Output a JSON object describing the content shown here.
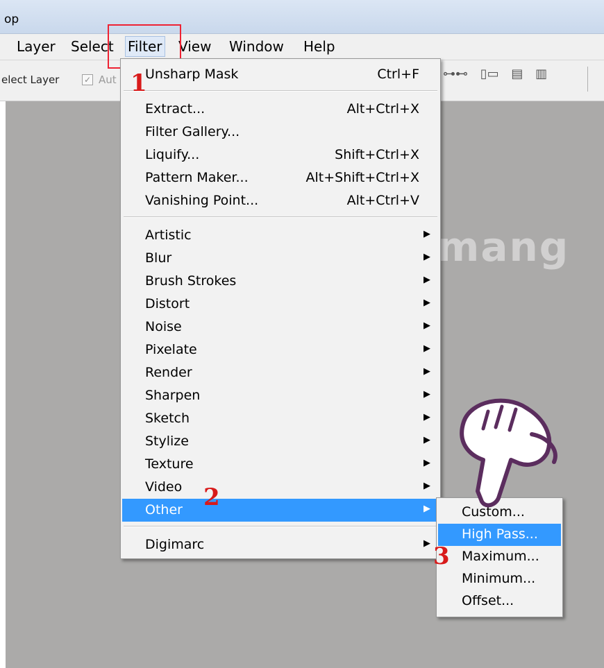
{
  "window": {
    "title_fragment": "op"
  },
  "menubar": {
    "items": [
      {
        "label": "Layer"
      },
      {
        "label": "Select"
      },
      {
        "label": "Filter"
      },
      {
        "label": "View"
      },
      {
        "label": "Window"
      },
      {
        "label": "Help"
      }
    ]
  },
  "toolbar": {
    "select_layer_label": "elect Layer",
    "auto_label": "Aut"
  },
  "filter_menu": {
    "top_item": {
      "label": "Unsharp Mask",
      "shortcut": "Ctrl+F"
    },
    "group1": [
      {
        "label": "Extract...",
        "shortcut": "Alt+Ctrl+X"
      },
      {
        "label": "Filter Gallery...",
        "shortcut": ""
      },
      {
        "label": "Liquify...",
        "shortcut": "Shift+Ctrl+X"
      },
      {
        "label": "Pattern Maker...",
        "shortcut": "Alt+Shift+Ctrl+X"
      },
      {
        "label": "Vanishing Point...",
        "shortcut": "Alt+Ctrl+V"
      }
    ],
    "group2": [
      {
        "label": "Artistic"
      },
      {
        "label": "Blur"
      },
      {
        "label": "Brush Strokes"
      },
      {
        "label": "Distort"
      },
      {
        "label": "Noise"
      },
      {
        "label": "Pixelate"
      },
      {
        "label": "Render"
      },
      {
        "label": "Sharpen"
      },
      {
        "label": "Sketch"
      },
      {
        "label": "Stylize"
      },
      {
        "label": "Texture"
      },
      {
        "label": "Video"
      },
      {
        "label": "Other"
      }
    ],
    "group3": [
      {
        "label": "Digimarc"
      }
    ]
  },
  "other_submenu": [
    {
      "label": "Custom..."
    },
    {
      "label": "High Pass..."
    },
    {
      "label": "Maximum..."
    },
    {
      "label": "Minimum..."
    },
    {
      "label": "Offset..."
    }
  ],
  "annotations": {
    "step1": "1",
    "step2": "2",
    "step3": "3"
  },
  "watermark": "uantrimang",
  "colors": {
    "highlight": "#3399ff",
    "annotation": "#d81a1a",
    "canvas": "#abaaa9"
  },
  "icons": {
    "submenu_arrow": "triangle-right",
    "pointer": "pointing-hand"
  }
}
